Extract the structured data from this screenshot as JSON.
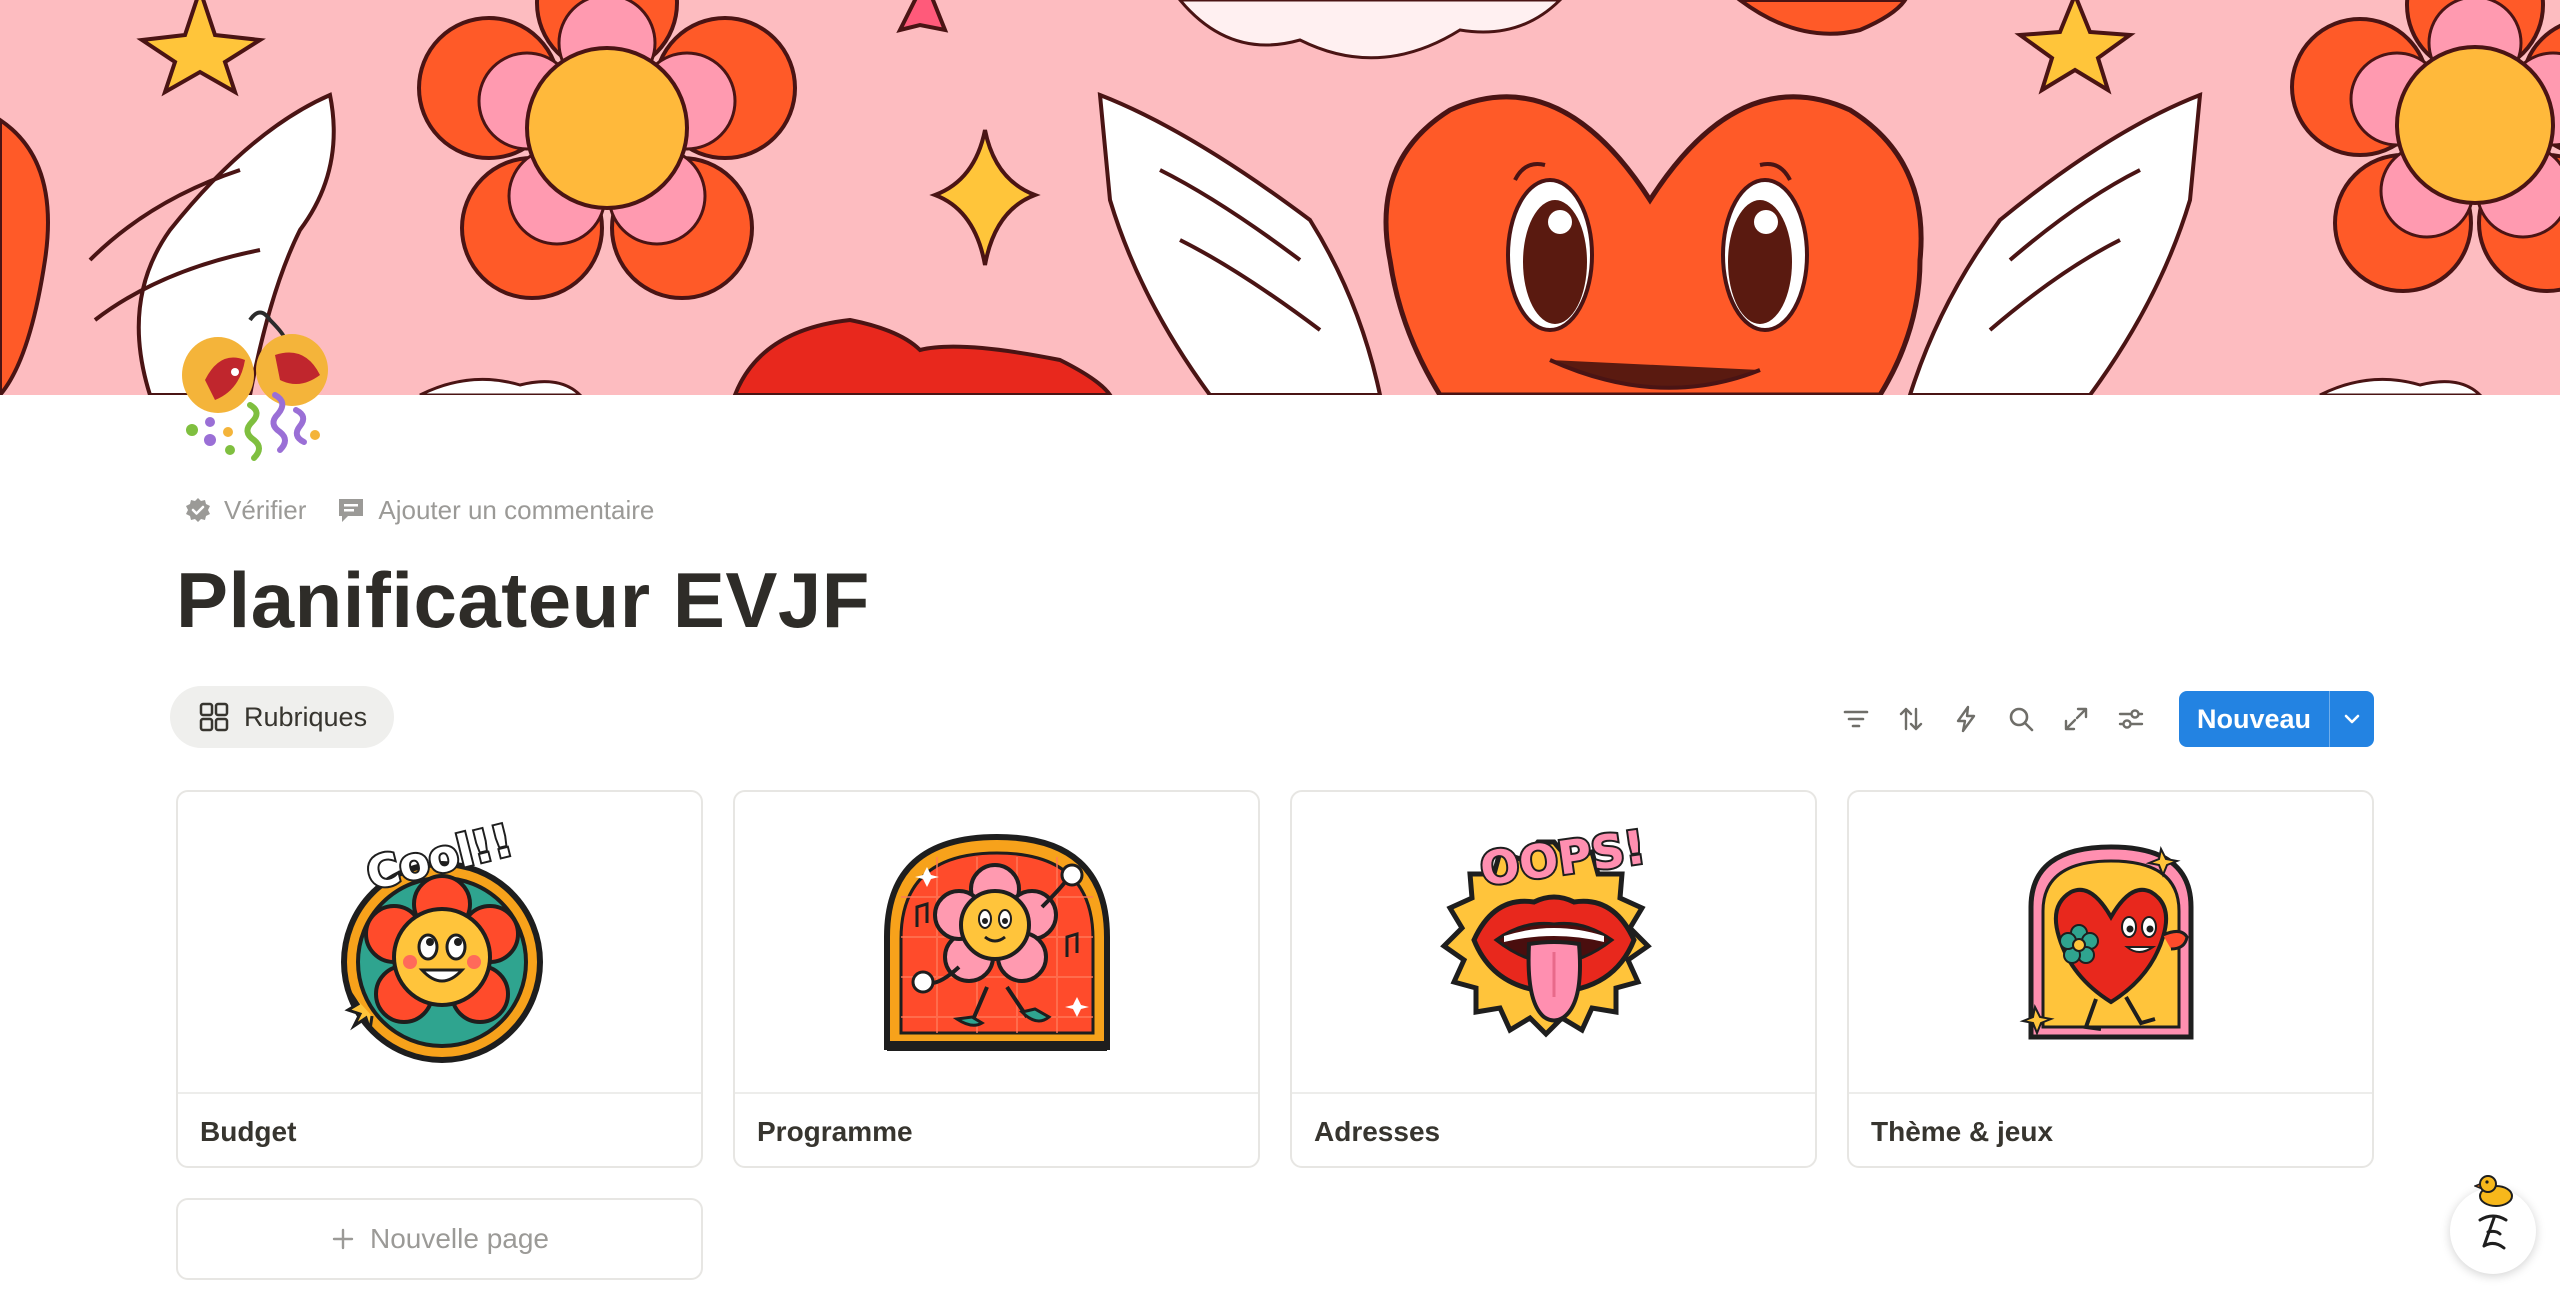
{
  "page": {
    "title": "Planificateur EVJF",
    "actions": {
      "verify_label": "Vérifier",
      "comment_label": "Ajouter un commentaire"
    }
  },
  "view": {
    "tab_label": "Rubriques",
    "tab_icon": "gallery-grid-icon"
  },
  "toolbar": {
    "icons": [
      "filter-icon",
      "sort-icon",
      "lightning-icon",
      "search-icon",
      "expand-icon",
      "settings-sliders-icon"
    ],
    "new_label": "Nouveau",
    "accent": "#2383e2"
  },
  "gallery": {
    "cards": [
      {
        "title": "Budget",
        "sticker": "cool-flower-sticker"
      },
      {
        "title": "Programme",
        "sticker": "dancing-flower-sticker"
      },
      {
        "title": "Adresses",
        "sticker": "oops-lips-sticker"
      },
      {
        "title": "Thème & jeux",
        "sticker": "heart-character-sticker"
      }
    ],
    "new_page_label": "Nouvelle page"
  },
  "sticker_texts": {
    "budget": "Cool!!",
    "adresses": "OOPS!"
  },
  "colors": {
    "cover_bg": "#fdbcc0",
    "red_orange": "#ff5a28",
    "yellow": "#ffb93b",
    "pink": "#ff8fb0"
  }
}
